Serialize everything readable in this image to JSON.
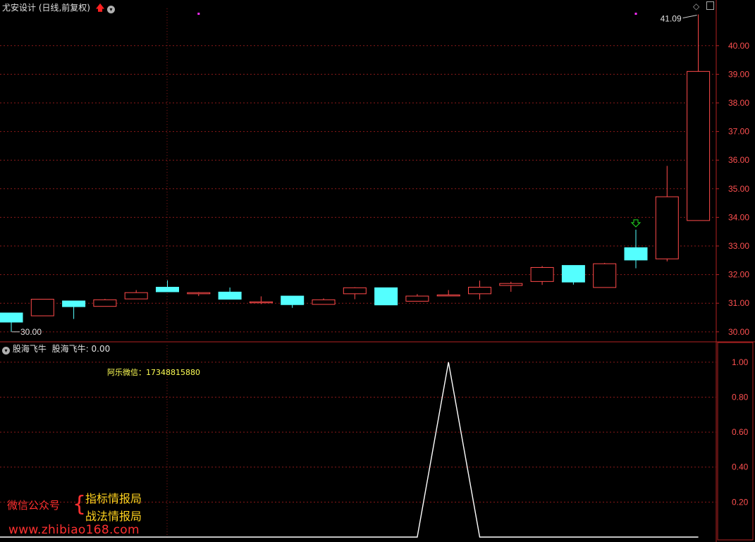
{
  "header": {
    "title": "尤安设计 (日线,前复权)",
    "arrow_icon": "red-up-arrow-icon",
    "dropdown_icon": "chevron-down-icon",
    "right_icons": [
      "diamond-icon",
      "panel-toggle-icon"
    ]
  },
  "indicator": {
    "title": "股海飞牛",
    "value_label": "股海飞牛: 0.00",
    "note": "阿乐微信：17348815880"
  },
  "watermark": {
    "left": "微信公众号",
    "line1": "指标情报局",
    "line2": "战法情报局",
    "url": "www.zhibiao168.com"
  },
  "colors": {
    "up": "#ff4a4a",
    "down": "#54ffff",
    "axis": "#b22222",
    "grid": "#8b1a1a",
    "signal": "#ff2cff",
    "indicator_line": "#ffffff",
    "note": "#ffff55",
    "watermark_red": "#ff3030",
    "watermark_yellow": "#ffd21e"
  },
  "chart_data": [
    {
      "type": "candlestick",
      "ylim": [
        29.7,
        41.3
      ],
      "yticks": [
        "30.00",
        "31.00",
        "32.00",
        "33.00",
        "34.00",
        "35.00",
        "36.00",
        "37.00",
        "38.00",
        "39.00",
        "40.00"
      ],
      "annotations": {
        "max": "41.09",
        "min": "30.00"
      },
      "candles": [
        {
          "o": 30.66,
          "h": 30.66,
          "l": 30.0,
          "c": 30.34
        },
        {
          "o": 30.56,
          "h": 31.14,
          "l": 30.56,
          "c": 31.14
        },
        {
          "o": 31.08,
          "h": 31.08,
          "l": 30.45,
          "c": 30.88
        },
        {
          "o": 30.89,
          "h": 31.15,
          "l": 30.89,
          "c": 31.12
        },
        {
          "o": 31.15,
          "h": 31.46,
          "l": 31.15,
          "c": 31.37
        },
        {
          "o": 31.56,
          "h": 31.8,
          "l": 31.4,
          "c": 31.4
        },
        {
          "o": 31.33,
          "h": 31.39,
          "l": 31.25,
          "c": 31.37
        },
        {
          "o": 31.39,
          "h": 31.55,
          "l": 31.13,
          "c": 31.14
        },
        {
          "o": 31.05,
          "h": 31.24,
          "l": 30.97,
          "c": 31.05
        },
        {
          "o": 31.25,
          "h": 31.25,
          "l": 30.84,
          "c": 30.95
        },
        {
          "o": 30.96,
          "h": 31.17,
          "l": 30.96,
          "c": 31.12
        },
        {
          "o": 31.33,
          "h": 31.56,
          "l": 31.14,
          "c": 31.54
        },
        {
          "o": 31.54,
          "h": 31.54,
          "l": 30.94,
          "c": 30.94
        },
        {
          "o": 31.07,
          "h": 31.32,
          "l": 31.07,
          "c": 31.25
        },
        {
          "o": 31.27,
          "h": 31.46,
          "l": 31.25,
          "c": 31.29
        },
        {
          "o": 31.33,
          "h": 31.79,
          "l": 31.13,
          "c": 31.56
        },
        {
          "o": 31.62,
          "h": 31.75,
          "l": 31.4,
          "c": 31.69
        },
        {
          "o": 31.76,
          "h": 32.3,
          "l": 31.64,
          "c": 32.25
        },
        {
          "o": 32.32,
          "h": 32.32,
          "l": 31.65,
          "c": 31.74
        },
        {
          "o": 31.55,
          "h": 32.41,
          "l": 31.55,
          "c": 32.38
        },
        {
          "o": 32.94,
          "h": 33.57,
          "l": 32.22,
          "c": 32.51
        },
        {
          "o": 32.55,
          "h": 35.8,
          "l": 32.46,
          "c": 34.72
        },
        {
          "o": 33.89,
          "h": 41.09,
          "l": 33.89,
          "c": 39.1
        }
      ],
      "signals": [
        {
          "index": 6,
          "kind": "dot"
        },
        {
          "index": 20,
          "kind": "dot"
        },
        {
          "index": 20,
          "kind": "arrow"
        }
      ]
    },
    {
      "type": "line",
      "title": "股海飞牛",
      "ylim": [
        0,
        1.08
      ],
      "yticks": [
        "0.20",
        "0.40",
        "0.60",
        "0.80",
        "1.00"
      ],
      "values": [
        0,
        0,
        0,
        0,
        0,
        0,
        0,
        0,
        0,
        0,
        0,
        0,
        0,
        0,
        1,
        0,
        0,
        0,
        0,
        0,
        0,
        0,
        0
      ]
    }
  ]
}
